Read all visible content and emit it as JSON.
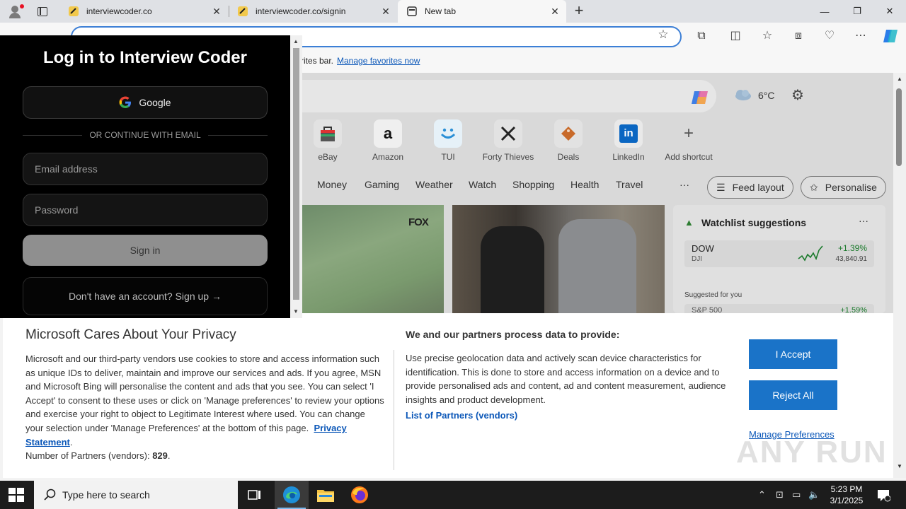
{
  "tabs": [
    {
      "title": "interviewcoder.co"
    },
    {
      "title": "interviewcoder.co/signin"
    },
    {
      "title": "New tab"
    }
  ],
  "favorites_bar": {
    "text": "rites bar.",
    "link": "Manage favorites now"
  },
  "newtab": {
    "weather": "6°C",
    "shortcuts": [
      "eBay",
      "Amazon",
      "TUI",
      "Forty Thieves",
      "Deals",
      "LinkedIn",
      "Add shortcut"
    ],
    "categories": [
      "Money",
      "Gaming",
      "Weather",
      "Watch",
      "Shopping",
      "Health",
      "Travel"
    ],
    "feed_layout": "Feed layout",
    "personalise": "Personalise",
    "weather_fox": "FOX",
    "watchlist": {
      "title": "Watchlist suggestions",
      "symbol": "DOW",
      "sub": "DJI",
      "change": "+1.39%",
      "price": "43,840.91",
      "suggested": "Suggested for you",
      "row2_left": "S&P 500",
      "row2_right": "+1.59%"
    }
  },
  "privacy": {
    "title": "Microsoft Cares About Your Privacy",
    "body": "Microsoft and our third-party vendors use cookies to store and access information such as unique IDs to deliver, maintain and improve our services and ads. If you agree, MSN and Microsoft Bing will personalise the content and ads that you see. You can select 'I Accept' to consent to these uses or click on 'Manage preferences' to review your options and exercise your right to object to Legitimate Interest where used.  You can change your selection under 'Manage Preferences' at the bottom of this page.",
    "privacy_link": "Privacy Statement",
    "partners_label": "Number of Partners (vendors):",
    "partners_count": "829",
    "heading2": "We and our partners process data to provide:",
    "body2": "Use precise geolocation data and actively scan device characteristics for identification. This is done to store and access information on a device and to provide personalised ads and content, ad and content measurement, audience insights and product development.",
    "partners_link": "List of Partners (vendors)",
    "accept": "I Accept",
    "reject": "Reject All",
    "manage": "Manage Preferences"
  },
  "watermark": "ANY RUN",
  "login": {
    "title": "Log in to Interview Coder",
    "google": "Google",
    "divider": "OR CONTINUE WITH EMAIL",
    "email_placeholder": "Email address",
    "password_placeholder": "Password",
    "signin": "Sign in",
    "signup": "Don't have an account? Sign up →"
  },
  "taskbar": {
    "search_placeholder": "Type here to search",
    "time": "5:23 PM",
    "date": "3/1/2025"
  },
  "colors": {
    "accent": "#1a73c8",
    "address_border": "#3c7fd6",
    "popup_bg": "#000000"
  }
}
